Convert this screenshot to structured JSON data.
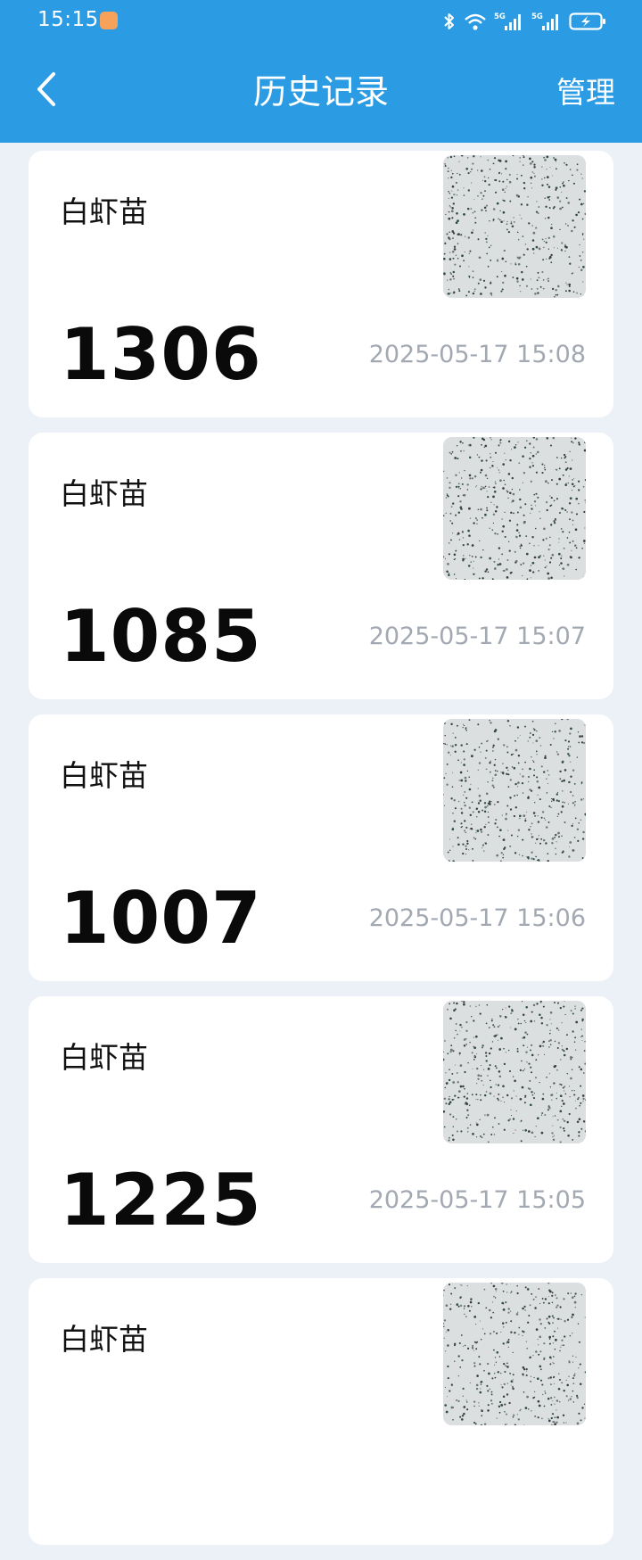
{
  "status_bar": {
    "time": "15:15",
    "network_1": "5G",
    "network_2": "5G"
  },
  "header": {
    "title": "历史记录",
    "manage_label": "管理"
  },
  "colors": {
    "header_bg": "#2b9be3",
    "page_bg": "#ecf1f7",
    "timestamp": "#a3a9b2"
  },
  "records": [
    {
      "name": "白虾苗",
      "count": "1306",
      "time": "2025-05-17 15:08"
    },
    {
      "name": "白虾苗",
      "count": "1085",
      "time": "2025-05-17 15:07"
    },
    {
      "name": "白虾苗",
      "count": "1007",
      "time": "2025-05-17 15:06"
    },
    {
      "name": "白虾苗",
      "count": "1225",
      "time": "2025-05-17 15:05"
    },
    {
      "name": "白虾苗",
      "count": "",
      "time": ""
    }
  ]
}
